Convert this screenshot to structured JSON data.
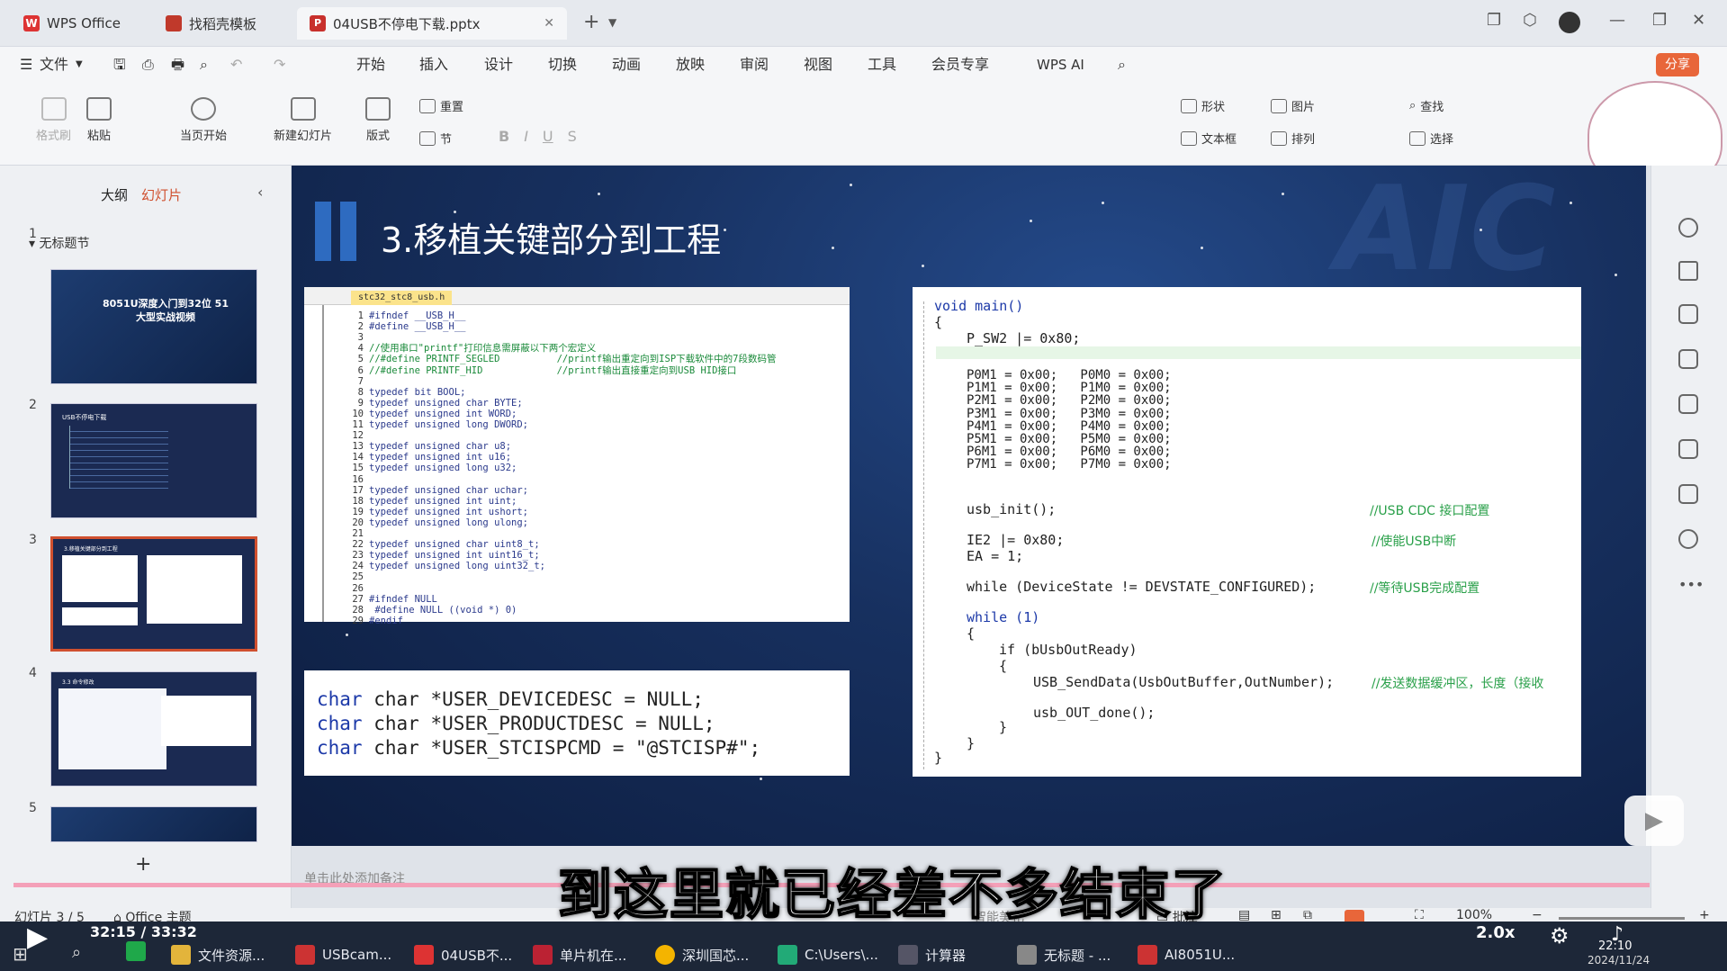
{
  "tabs": [
    {
      "label": "WPS Office"
    },
    {
      "label": "找稻壳模板"
    },
    {
      "label": "04USB不停电下载.pptx"
    }
  ],
  "menu": {
    "file": "文件",
    "items": [
      "开始",
      "插入",
      "设计",
      "切换",
      "动画",
      "放映",
      "审阅",
      "视图",
      "工具",
      "会员专享"
    ],
    "wps_ai": "WPS AI",
    "share": "分享"
  },
  "ribbon": {
    "format_painter": "格式刷",
    "paste": "粘贴",
    "play_from": "当页开始",
    "new_slide": "新建幻灯片",
    "layout": "版式",
    "section": "节",
    "reset": "重置",
    "shape": "形状",
    "picture": "图片",
    "find": "查找",
    "textbox": "文本框",
    "arrange": "排列",
    "select": "选择"
  },
  "leftpanel": {
    "outline": "大纲",
    "slides": "幻灯片",
    "section_title": "无标题节",
    "thumbs": [
      {
        "num": "1",
        "title": "8051U深度入门到32位 51大型实战视频"
      },
      {
        "num": "2",
        "title": "USB不停电下载"
      },
      {
        "num": "3",
        "title": "3.移植关键部分到工程"
      },
      {
        "num": "4",
        "title": "3.3 命令修改"
      },
      {
        "num": "5",
        "title": ""
      }
    ],
    "add": "+"
  },
  "slide": {
    "title": "3.移植关键部分到工程",
    "bg_text": "AIC",
    "file_tab": "stc32_stc8_usb.h",
    "left_code": [
      {
        "n": "1",
        "t": "#ifndef __USB_H__"
      },
      {
        "n": "2",
        "t": "#define __USB_H__"
      },
      {
        "n": "3",
        "t": ""
      },
      {
        "n": "4",
        "t": "//使用串口\"printf\"打印信息需屏蔽以下两个宏定义"
      },
      {
        "n": "5",
        "t": "//#define PRINTF_SEGLED          //printf输出重定向到ISP下载软件中的7段数码管"
      },
      {
        "n": "6",
        "t": "//#define PRINTF_HID             //printf输出直接重定向到USB HID接口"
      },
      {
        "n": "7",
        "t": ""
      },
      {
        "n": "8",
        "t": "typedef bit BOOL;"
      },
      {
        "n": "9",
        "t": "typedef unsigned char BYTE;"
      },
      {
        "n": "10",
        "t": "typedef unsigned int WORD;"
      },
      {
        "n": "11",
        "t": "typedef unsigned long DWORD;"
      },
      {
        "n": "12",
        "t": ""
      },
      {
        "n": "13",
        "t": "typedef unsigned char u8;"
      },
      {
        "n": "14",
        "t": "typedef unsigned int u16;"
      },
      {
        "n": "15",
        "t": "typedef unsigned long u32;"
      },
      {
        "n": "16",
        "t": ""
      },
      {
        "n": "17",
        "t": "typedef unsigned char uchar;"
      },
      {
        "n": "18",
        "t": "typedef unsigned int uint;"
      },
      {
        "n": "19",
        "t": "typedef unsigned int ushort;"
      },
      {
        "n": "20",
        "t": "typedef unsigned long ulong;"
      },
      {
        "n": "21",
        "t": ""
      },
      {
        "n": "22",
        "t": "typedef unsigned char uint8_t;"
      },
      {
        "n": "23",
        "t": "typedef unsigned int uint16_t;"
      },
      {
        "n": "24",
        "t": "typedef unsigned long uint32_t;"
      },
      {
        "n": "25",
        "t": ""
      },
      {
        "n": "26",
        "t": ""
      },
      {
        "n": "27",
        "t": "#ifndef NULL"
      },
      {
        "n": "28",
        "t": " #define NULL ((void *) 0)"
      },
      {
        "n": "29",
        "t": "#endif"
      }
    ],
    "usb_code": [
      "char *USER_DEVICEDESC = NULL;",
      "char *USER_PRODUCTDESC = NULL;",
      "char *USER_STCISPCMD = \"@STCISP#\";"
    ],
    "main_code": {
      "l1": "void main()",
      "l2": "{",
      "l3": "P_SW2 |= 0x80;",
      "port_rows": [
        "P0M1 = 0x00;   P0M0 = 0x00;",
        "P1M1 = 0x00;   P1M0 = 0x00;",
        "P2M1 = 0x00;   P2M0 = 0x00;",
        "P3M1 = 0x00;   P3M0 = 0x00;",
        "P4M1 = 0x00;   P4M0 = 0x00;",
        "P5M1 = 0x00;   P5M0 = 0x00;",
        "P6M1 = 0x00;   P6M0 = 0x00;",
        "P7M1 = 0x00;   P7M0 = 0x00;"
      ],
      "usb_init": "usb_init();",
      "usb_init_cm": "//USB CDC 接口配置",
      "ie2": "IE2 |= 0x80;",
      "ie2_cm": "//使能USB中断",
      "ea": "EA = 1;",
      "while1": "while (DeviceState != DEVSTATE_CONFIGURED);",
      "while1_cm": "//等待USB完成配置",
      "while2": "while (1)",
      "ob": "{",
      "if": "if (bUsbOutReady)",
      "ob2": "{",
      "send": "USB_SendData(UsbOutBuffer,OutNumber);",
      "send_cm": "//发送数据缓冲区，长度（接收",
      "done": "usb_OUT_done();",
      "cb2": "}",
      "cb": "}",
      "cb0": "}"
    }
  },
  "notes_placeholder": "单击此处添加备注",
  "status": {
    "slide": "幻灯片 3 / 5",
    "theme": "Office 主题",
    "comments": "批注",
    "zoom": "100%",
    "smart": "智能美化"
  },
  "video": {
    "time": "32:15 / 33:32",
    "speed": "2.0x",
    "subtitle": "到这里就已经差不多结束了"
  },
  "taskbar": {
    "items": [
      "文件资源...",
      "USBcam...",
      "04USB不...",
      "单片机在...",
      "深圳国芯...",
      "C:\\Users\\...",
      "计算器",
      "无标题 - ...",
      "AI8051U..."
    ],
    "time": "22:10",
    "date": "2024/11/24"
  }
}
